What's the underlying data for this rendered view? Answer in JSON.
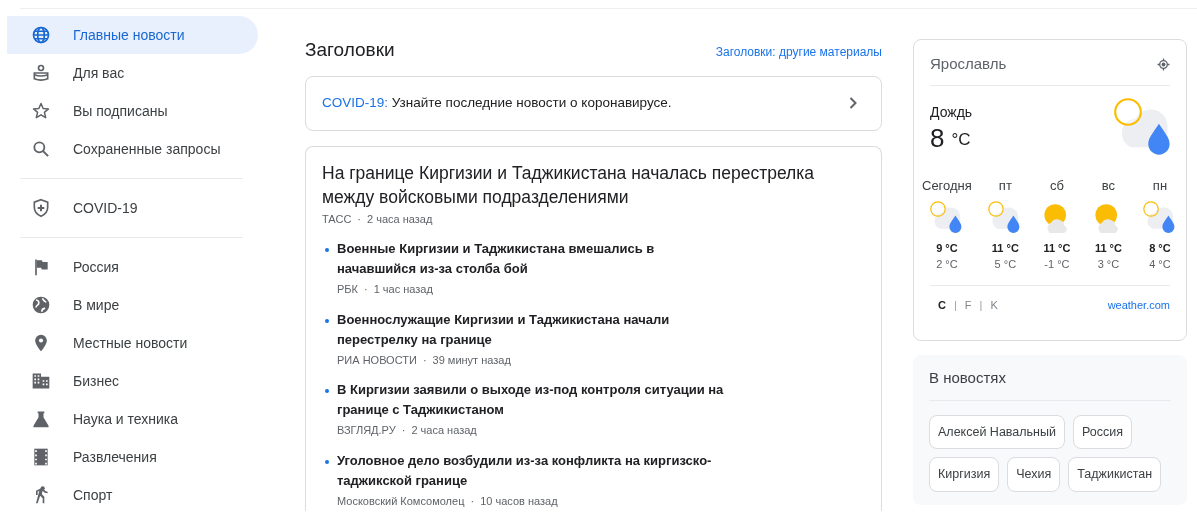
{
  "sidebar": {
    "groups": [
      [
        {
          "label": "Главные новости",
          "kind": "globe",
          "selected": true
        },
        {
          "label": "Для вас",
          "kind": "person",
          "selected": false
        },
        {
          "label": "Вы подписаны",
          "kind": "star",
          "selected": false
        },
        {
          "label": "Сохраненные запросы",
          "kind": "search",
          "selected": false
        }
      ],
      [
        {
          "label": "COVID-19",
          "kind": "shield",
          "selected": false
        }
      ],
      [
        {
          "label": "Россия",
          "kind": "flag",
          "selected": false
        },
        {
          "label": "В мире",
          "kind": "earth",
          "selected": false
        },
        {
          "label": "Местные новости",
          "kind": "pin",
          "selected": false
        },
        {
          "label": "Бизнес",
          "kind": "building",
          "selected": false
        },
        {
          "label": "Наука и техника",
          "kind": "flask",
          "selected": false
        },
        {
          "label": "Развлечения",
          "kind": "film",
          "selected": false
        },
        {
          "label": "Спорт",
          "kind": "sport",
          "selected": false
        }
      ]
    ]
  },
  "headlines": {
    "title": "Заголовки",
    "more_link": "Заголовки: другие материалы",
    "covid_banner": {
      "link": "COVID-19:",
      "text": "Узнайте последние новости о коронавирусе."
    },
    "story": {
      "title": "На границе Киргизии и Таджикистана началась перестрелка между войсковыми подразделениями",
      "source": "ТАСС",
      "separator": "·",
      "time": "2 часа назад",
      "related": [
        {
          "title": "Военные Киргизии и Таджикистана вмешались в начавшийся из-за столба бой",
          "source": "РБК",
          "separator": "·",
          "time": "1 час назад"
        },
        {
          "title": "Военнослужащие Киргизии и Таджикистана начали перестрелку на границе",
          "source": "РИА НОВОСТИ",
          "separator": "·",
          "time": "39 минут назад"
        },
        {
          "title": "В Киргизии заявили о выходе из-под контроля ситуации на границе с Таджикистаном",
          "source": "ВЗГЛЯД.РУ",
          "separator": "·",
          "time": "2 часа назад"
        },
        {
          "title": "Уголовное дело возбудили из-за конфликта на киргизско-таджикской границе",
          "source": "Московский Комсомолец",
          "separator": "·",
          "time": "10 часов назад"
        }
      ]
    }
  },
  "weather": {
    "city": "Ярославль",
    "condition": "Дождь",
    "temperature": "8",
    "unit": "°C",
    "kind": "rain",
    "forecast": [
      {
        "day": "Сегодня",
        "kind": "rain",
        "high": "9 °C",
        "low": "2 °C"
      },
      {
        "day": "пт",
        "kind": "rain",
        "high": "11 °C",
        "low": "5 °C"
      },
      {
        "day": "сб",
        "kind": "sun",
        "high": "11 °C",
        "low": "-1 °C"
      },
      {
        "day": "вс",
        "kind": "sun",
        "high": "11 °C",
        "low": "3 °C"
      },
      {
        "day": "пн",
        "kind": "rain",
        "high": "8 °C",
        "low": "4 °C"
      }
    ],
    "units": [
      {
        "label": "C",
        "selected": true
      },
      {
        "label": "F",
        "selected": false
      },
      {
        "label": "K",
        "selected": false
      }
    ],
    "unit_separators": [
      "|",
      "|"
    ],
    "source": "weather.com"
  },
  "in_the_news": {
    "title": "В новостях",
    "topics": [
      "Алексей Навальный",
      "Россия",
      "Киргизия",
      "Чехия",
      "Таджикистан"
    ]
  }
}
